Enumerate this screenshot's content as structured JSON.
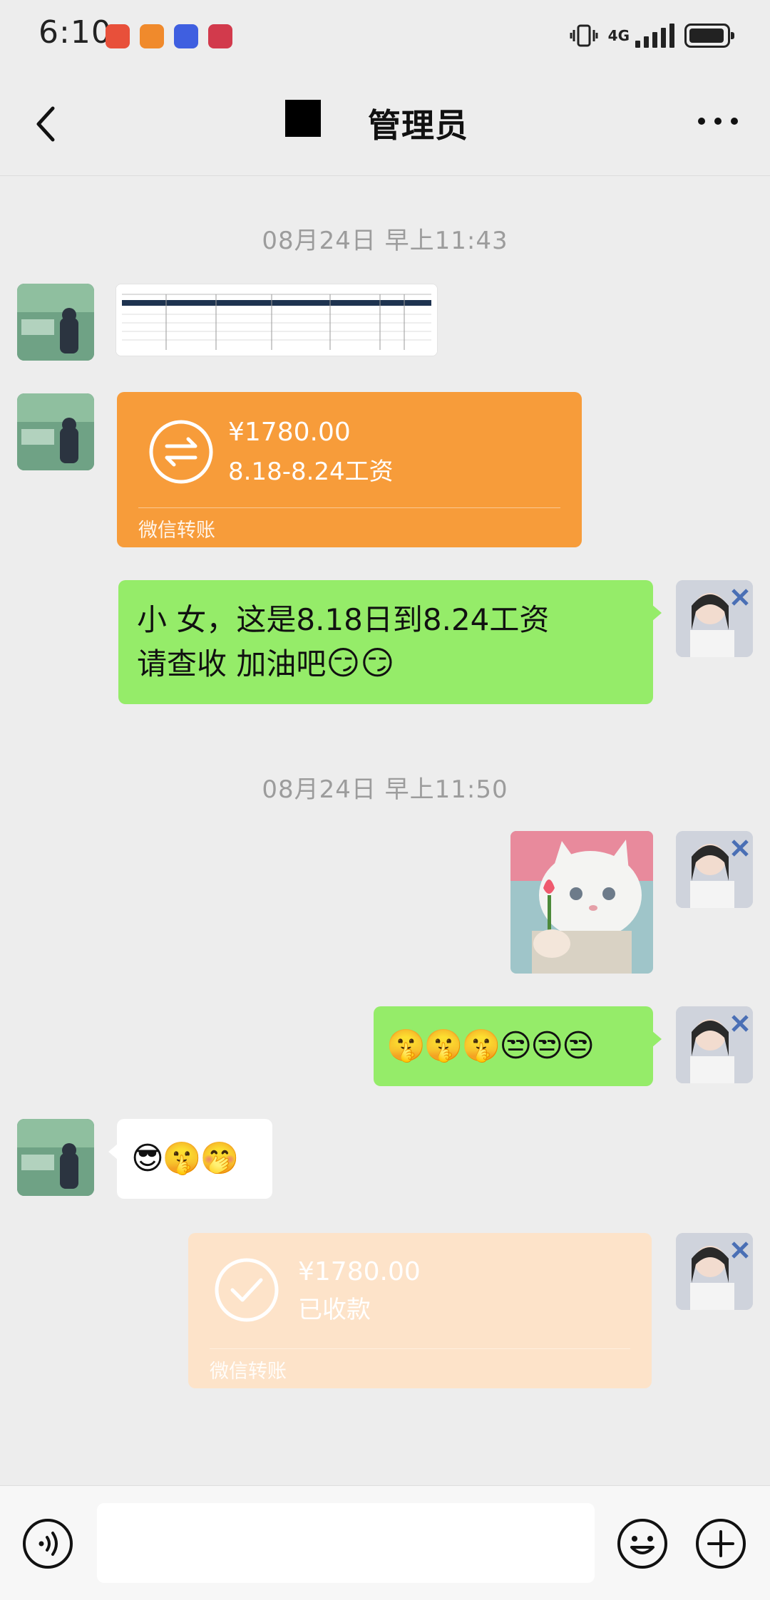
{
  "status_bar": {
    "time": "6:10",
    "network": "4G"
  },
  "nav": {
    "title": "管理员"
  },
  "messages": {
    "ts1": "08月24日 早上11:43",
    "transfer1": {
      "amount": "¥1780.00",
      "desc": "8.18-8.24工资",
      "footer": "微信转账"
    },
    "text1": {
      "line1": "小 女，这是8.18日到8.24工资",
      "line2_text": "请查收 加油吧",
      "line2_emoji": "😏😏"
    },
    "ts2": "08月24日 早上11:50",
    "emoji_row_self": "🤫🤫🤫😒😒😒",
    "emoji_row_peer": "😎🤫🤭",
    "transfer2": {
      "amount": "¥1780.00",
      "desc": "已收款",
      "footer": "微信转账"
    }
  },
  "colors": {
    "background": "#ededed",
    "bubble_self": "#95ec69",
    "transfer_pending": "#f79c3a",
    "transfer_received": "#fde3c9"
  },
  "icons": [
    "back-icon",
    "more-icon",
    "voice-icon",
    "emoji-icon",
    "plus-icon",
    "transfer-icon",
    "check-icon"
  ]
}
